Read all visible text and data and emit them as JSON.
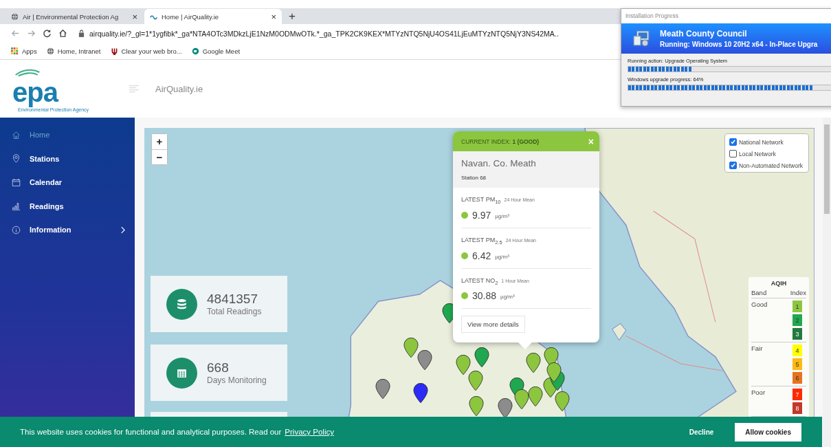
{
  "browser": {
    "tabs": [
      {
        "title": "Air | Environmental Protection Ag",
        "selected": false,
        "kind": "globe"
      },
      {
        "title": "Home | AirQuality.ie",
        "selected": true,
        "kind": "epa"
      }
    ],
    "close_symbol": "×",
    "new_tab_symbol": "+",
    "url": "airquality.ie/?_gl=1*1ygfibk*_ga*NTA4OTc3MDkzLjE1NzM0ODMwOTk.*_ga_TPK2CK9KEX*MTYzNTQ5NjU4OS41LjEuMTYzNTQ5NjY3NS42MA..",
    "bookmarks": [
      {
        "label": "Apps",
        "kind": "apps"
      },
      {
        "label": "Home, Intranet",
        "kind": "globe"
      },
      {
        "label": "Clear your web bro...",
        "kind": "trident"
      },
      {
        "label": "Google Meet",
        "kind": "meet"
      }
    ]
  },
  "header": {
    "logo": "epa",
    "logo_caption": "Environmental Protection Agency",
    "title": "AirQuality.ie"
  },
  "sidebar": {
    "items": [
      {
        "label": "Home",
        "kind": "home",
        "selected": true
      },
      {
        "label": "Stations",
        "kind": "pin",
        "selected": false
      },
      {
        "label": "Calendar",
        "kind": "calendar",
        "selected": false
      },
      {
        "label": "Readings",
        "kind": "bars",
        "selected": false
      },
      {
        "label": "Information",
        "kind": "info",
        "selected": false,
        "has_submenu": true
      }
    ]
  },
  "map": {
    "zoom_in": "+",
    "zoom_out": "−",
    "networks": [
      {
        "label": "National Network",
        "checked": true
      },
      {
        "label": "Local Network",
        "checked": false
      },
      {
        "label": "Non-Automated Network",
        "checked": true
      }
    ],
    "stats": [
      {
        "value": "4841357",
        "label": "Total Readings",
        "kind": "database"
      },
      {
        "value": "668",
        "label": "Days Monitoring",
        "kind": "calendar"
      }
    ],
    "markers": [
      {
        "color": "#1fa84f"
      },
      {
        "color": "#8cc63f"
      },
      {
        "color": "#8c8c8c"
      },
      {
        "color": "#8c8c8c"
      },
      {
        "color": "#2b2bf5"
      },
      {
        "color": "#8cc63f"
      },
      {
        "color": "#1fa84f"
      },
      {
        "color": "#8cc63f"
      },
      {
        "color": "#8cc63f"
      },
      {
        "color": "#8cc63f"
      },
      {
        "color": "#1fa84f"
      },
      {
        "color": "#8cc63f"
      },
      {
        "color": "#8cc63f"
      },
      {
        "color": "#1fa84f"
      },
      {
        "color": "#8cc63f"
      },
      {
        "color": "#8cc63f"
      },
      {
        "color": "#8cc63f"
      },
      {
        "color": "#8c8c8c"
      },
      {
        "color": "#8cc63f"
      }
    ],
    "popup": {
      "index_text": "CURRENT INDEX: **1 (GOOD)**",
      "close": "×",
      "station_name": "Navan. Co. Meath",
      "station_id": "Station 68",
      "readings": [
        {
          "title": "LATEST PM$_{10}$",
          "period": "24 Hour Mean",
          "value": "9.97",
          "unit": "µg/m³",
          "color": "#8cc63f"
        },
        {
          "title": "LATEST PM$_{2.5}$",
          "period": "24 Hour Mean",
          "value": "6.42",
          "unit": "µg/m³",
          "color": "#8cc63f"
        },
        {
          "title": "LATEST NO$_{2}$",
          "period": "1 Hour Mean",
          "value": "30.88",
          "unit": "µg/m³",
          "color": "#8cc63f"
        }
      ],
      "details_button": "View more details"
    },
    "legend": {
      "title": "AQIH",
      "band_heading": "Band",
      "index_heading": "Index",
      "bands": [
        {
          "band": "Good",
          "indices": [
            {
              "label": "1",
              "color": "#8cc63f"
            },
            {
              "label": "2",
              "color": "#1fa84f"
            },
            {
              "label": "3",
              "color": "#237a3f"
            }
          ]
        },
        {
          "band": "Fair",
          "indices": [
            {
              "label": "4",
              "color": "#ffff00"
            },
            {
              "label": "5",
              "color": "#ffb90f"
            },
            {
              "label": "6",
              "color": "#e8731e"
            }
          ]
        },
        {
          "band": "Poor",
          "indices": [
            {
              "label": "7",
              "color": "#ff2a00"
            },
            {
              "label": "8",
              "color": "#c0392b"
            }
          ]
        }
      ]
    }
  },
  "cookie_banner": {
    "text": "This website uses cookies for functional and analytical purposes. Read our",
    "link": "Privacy Policy",
    "decline": "Decline",
    "accept": "Allow cookies"
  },
  "installer": {
    "title": "Installation Progress",
    "organisation": "Meath County Council",
    "task": "Running: Windows 10 20H2 x64 - In-Place Upgra",
    "steps": [
      {
        "label": "Running action: Upgrade Operating System",
        "level": 0.22
      },
      {
        "label": "Windows upgrade progress: 64%",
        "level": 0.64
      }
    ]
  }
}
